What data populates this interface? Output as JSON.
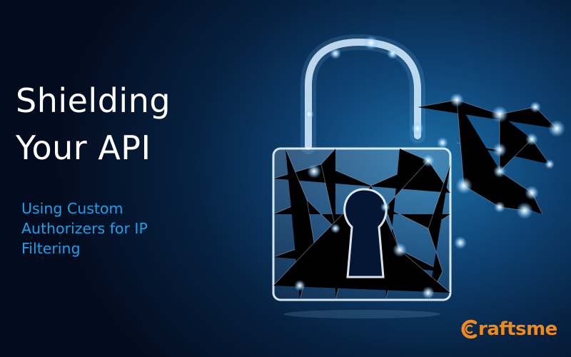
{
  "title": {
    "line1": "Shielding",
    "line2": "Your API"
  },
  "subtitle": {
    "line1": "Using Custom",
    "line2": "Authorizers for IP",
    "line3": "Filtering"
  },
  "logo": {
    "text": "raftsme",
    "full_text": "craftsme",
    "color": "#f08a1c"
  },
  "illustration": {
    "icon": "padlock-icon",
    "style": "glowing polygon mesh",
    "state": "unlocked"
  },
  "colors": {
    "title": "#ffffff",
    "subtitle": "#1ea0e6",
    "background_dark": "#030c1f",
    "background_glow": "#1c6fa8"
  }
}
